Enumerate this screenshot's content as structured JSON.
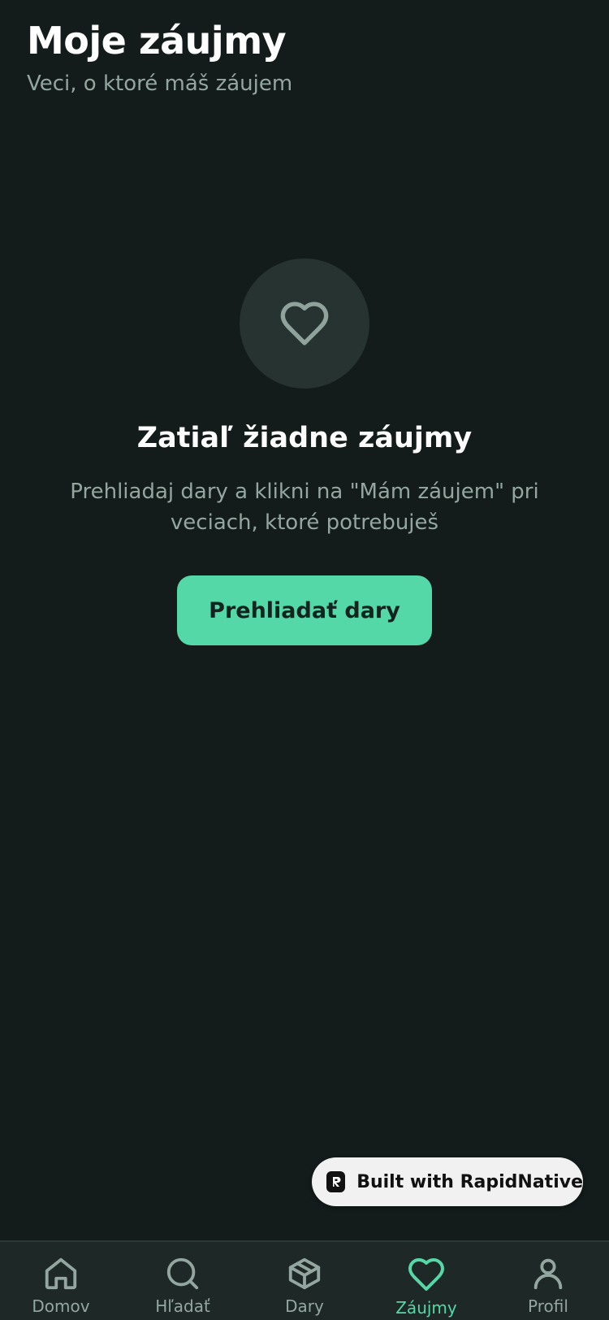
{
  "header": {
    "title": "Moje záujmy",
    "subtitle": "Veci, o ktoré máš záujem"
  },
  "empty_state": {
    "icon": "heart-icon",
    "title": "Zatiaľ žiadne záujmy",
    "text": "Prehliadaj dary a klikni na \"Mám záujem\" pri veciach, ktoré potrebuješ",
    "button_label": "Prehliadať dary"
  },
  "badge": {
    "label": "Built with RapidNative"
  },
  "tabbar": {
    "items": [
      {
        "label": "Domov",
        "icon": "home-icon",
        "active": false
      },
      {
        "label": "Hľadať",
        "icon": "search-icon",
        "active": false
      },
      {
        "label": "Dary",
        "icon": "box-icon",
        "active": false
      },
      {
        "label": "Záujmy",
        "icon": "heart-icon",
        "active": true
      },
      {
        "label": "Profil",
        "icon": "user-icon",
        "active": false
      }
    ]
  },
  "colors": {
    "background": "#131c1a",
    "accent": "#55d8a7",
    "muted_text": "#93a6a0",
    "tabbar": "#1e2826"
  }
}
